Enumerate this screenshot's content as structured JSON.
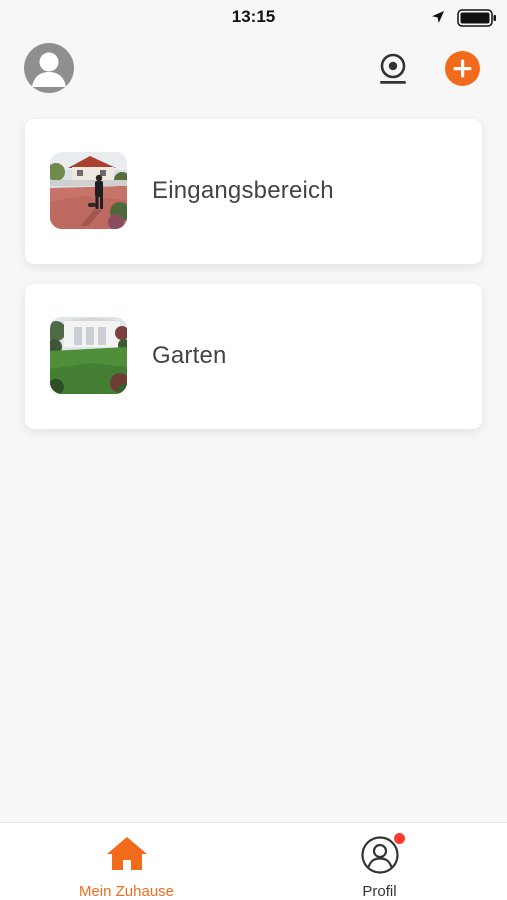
{
  "status_bar": {
    "time": "13:15"
  },
  "header": {
    "avatar_icon": "user-avatar-icon",
    "camera_icon": "webcam-icon",
    "add_icon": "plus-icon",
    "accent_color": "#f26b1d"
  },
  "rooms": [
    {
      "label": "Eingangsbereich",
      "thumbnail": "entrance-photo"
    },
    {
      "label": "Garten",
      "thumbnail": "garden-photo"
    }
  ],
  "tab_bar": {
    "tabs": [
      {
        "label": "Mein Zuhause",
        "icon": "home-icon",
        "active": true
      },
      {
        "label": "Profil",
        "icon": "profile-icon",
        "badge": "notification-dot"
      }
    ],
    "active_color": "#f26b1d"
  }
}
